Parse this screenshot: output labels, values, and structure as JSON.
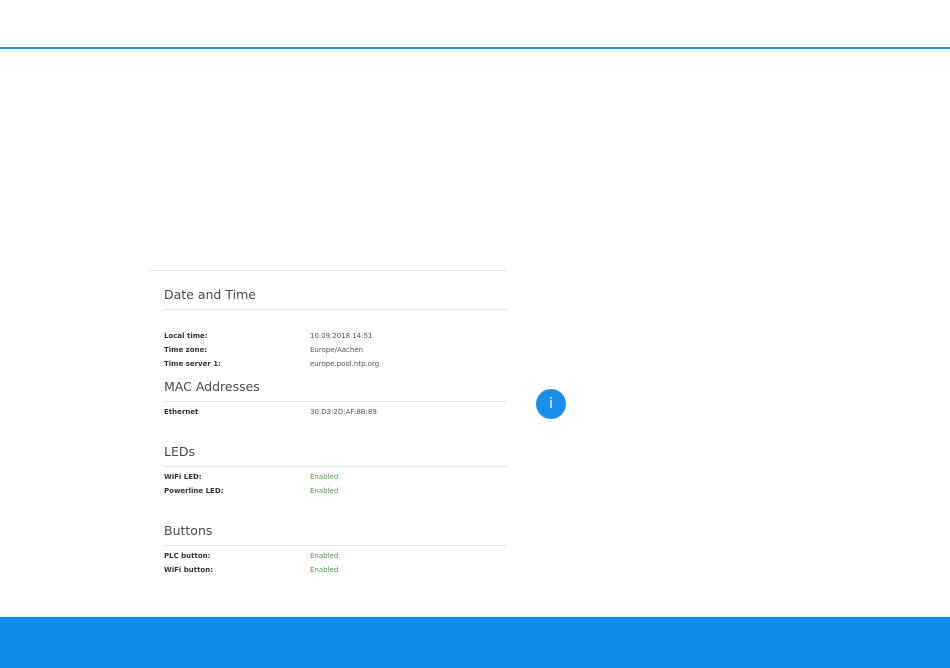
{
  "sections": {
    "date_time": {
      "title": "Date and Time",
      "rows": [
        {
          "label": "Local time:",
          "value": "10.09.2018 14:51"
        },
        {
          "label": "Time zone:",
          "value": "Europe/Aachen"
        },
        {
          "label": "Time server 1:",
          "value": "europe.pool.ntp.org"
        }
      ]
    },
    "mac": {
      "title": "MAC Addresses",
      "rows": [
        {
          "label": "Ethernet",
          "value": "30:D3:2D:AF:8B:89"
        }
      ]
    },
    "leds": {
      "title": "LEDs",
      "rows": [
        {
          "label": "WiFi LED:",
          "value": "Enabled"
        },
        {
          "label": "Powerline LED:",
          "value": "Enabled"
        }
      ]
    },
    "buttons": {
      "title": "Buttons",
      "rows": [
        {
          "label": "PLC button:",
          "value": "Enabled"
        },
        {
          "label": "WiFi button:",
          "value": "Enabled"
        }
      ]
    }
  },
  "info_button": {
    "glyph": "i",
    "icon": "info-icon"
  },
  "colors": {
    "accent": "#1b8fe8",
    "footer": "#0d8ce9",
    "enabled": "#48a148"
  }
}
